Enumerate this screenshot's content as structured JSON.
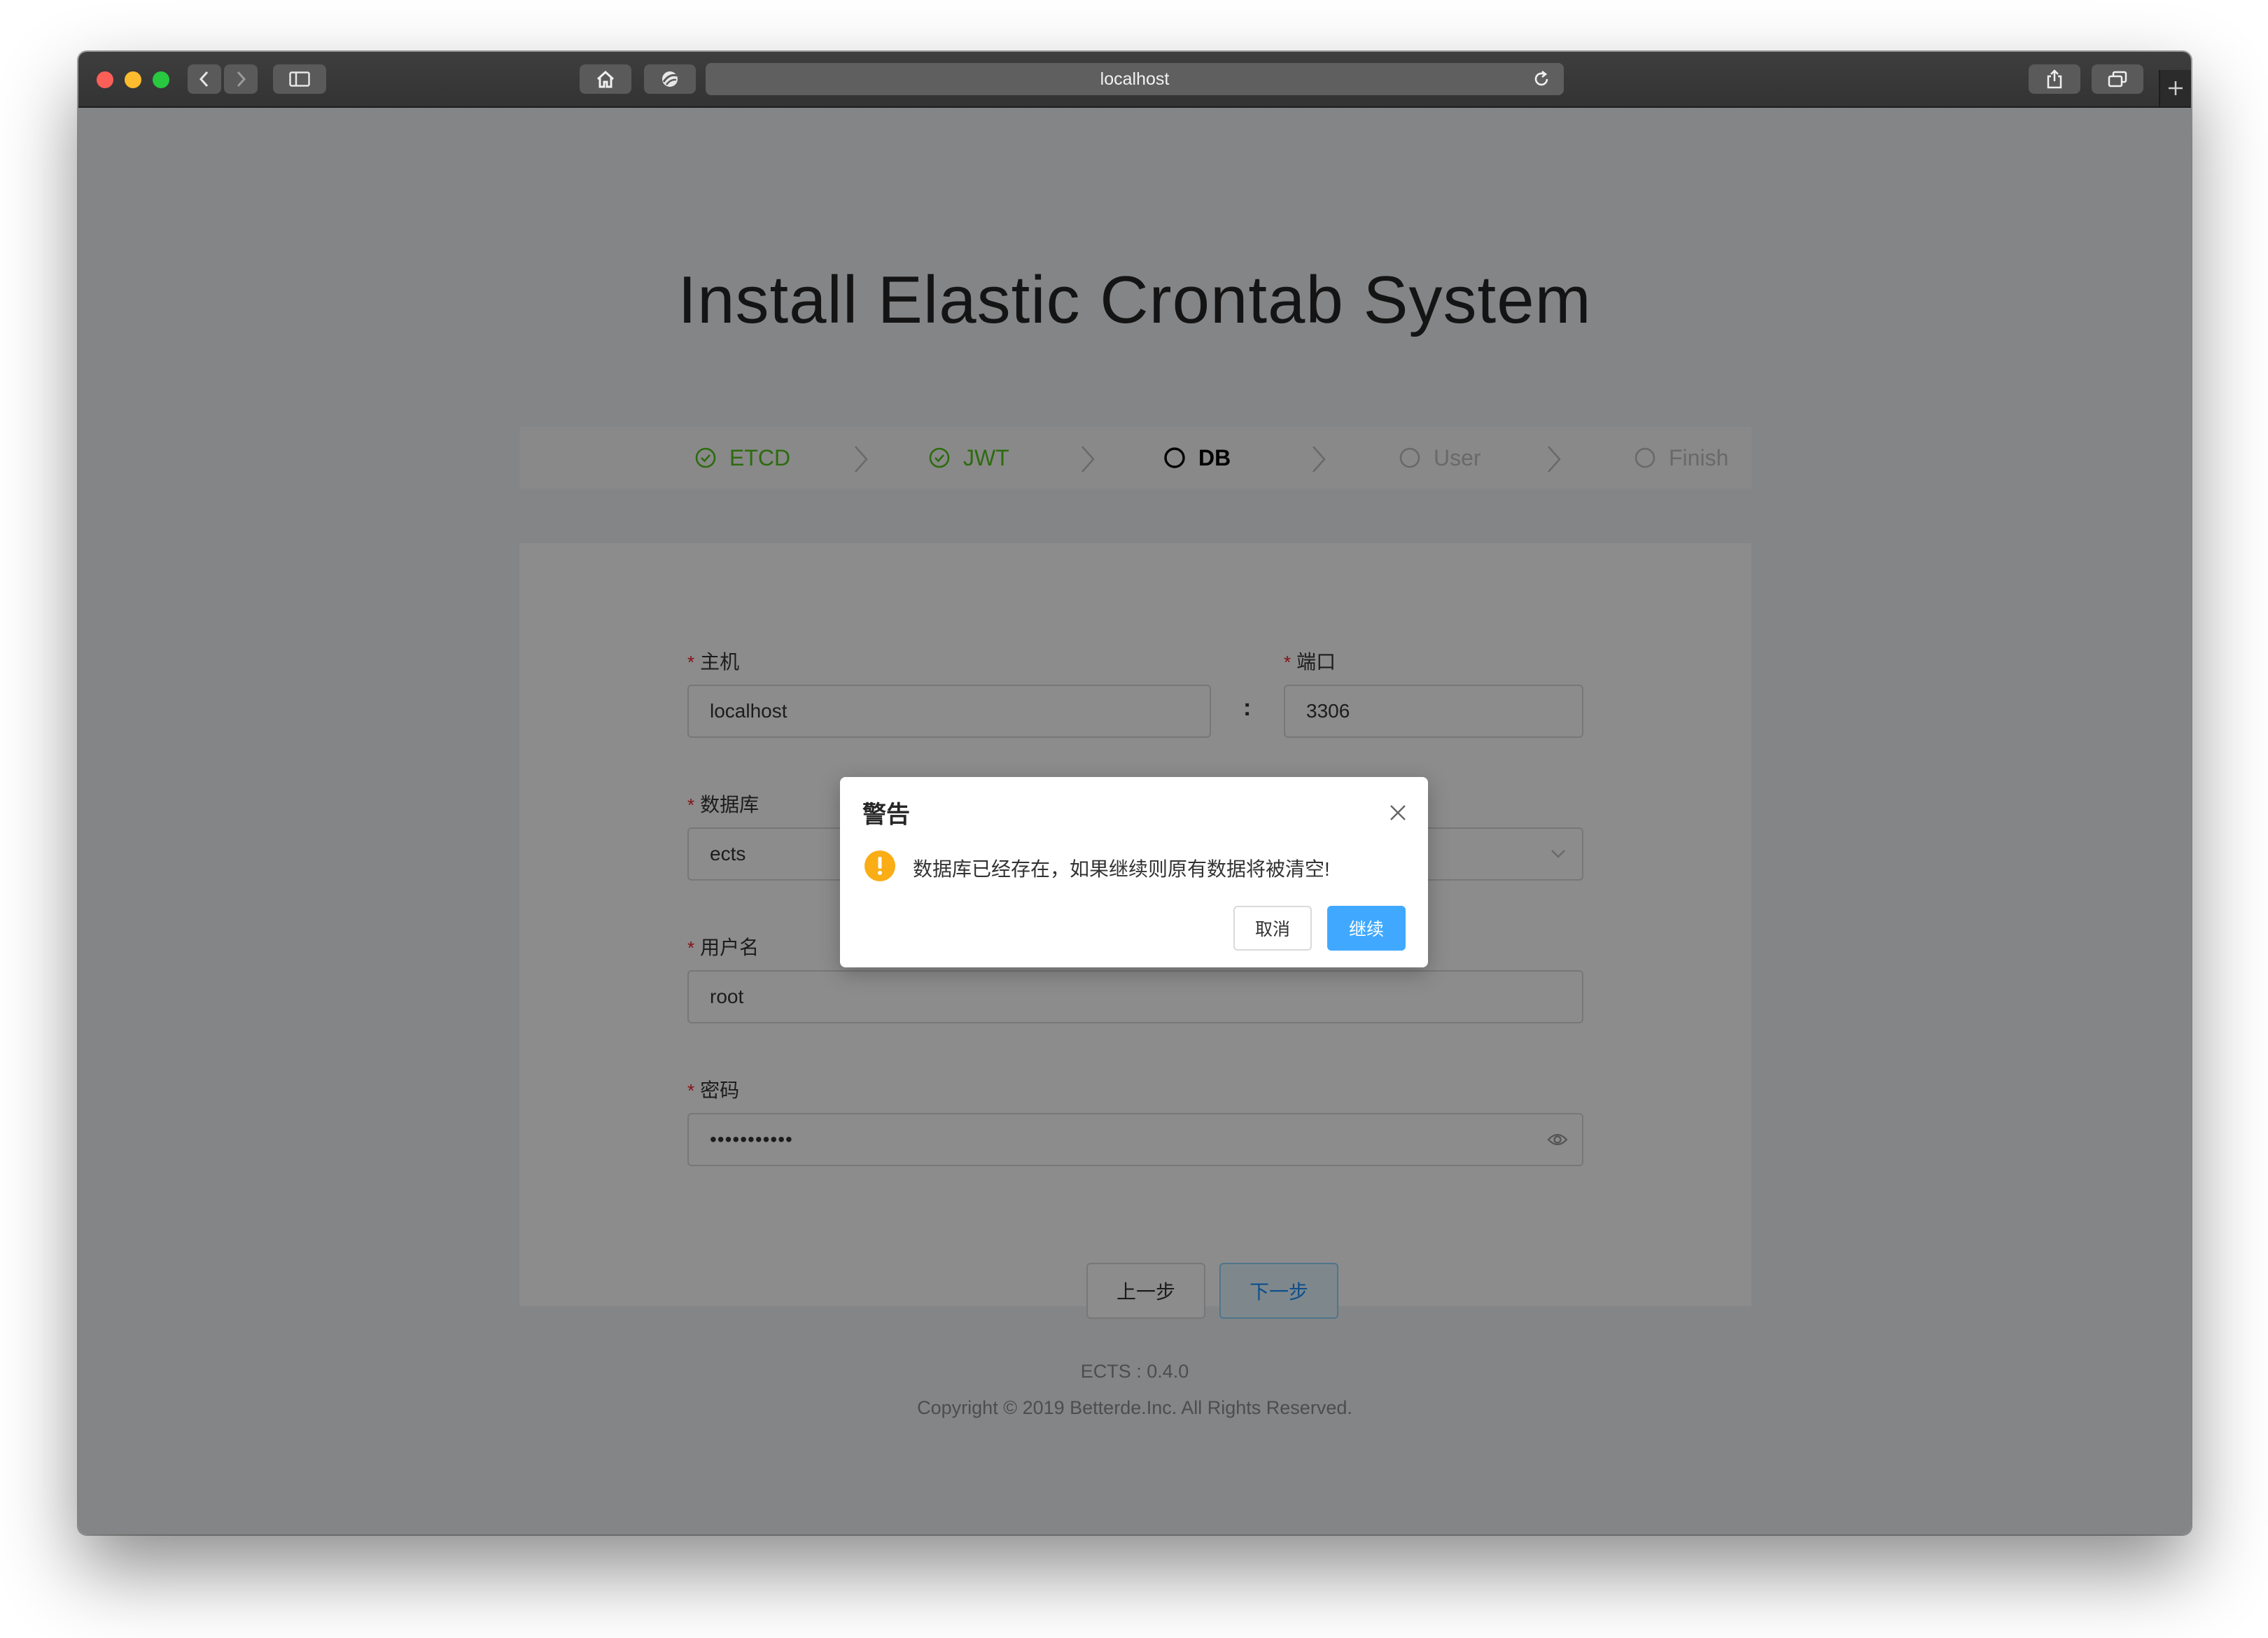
{
  "browser": {
    "url": "localhost"
  },
  "page": {
    "title": "Install Elastic Crontab System"
  },
  "steps": [
    {
      "label": "ETCD",
      "status": "done"
    },
    {
      "label": "JWT",
      "status": "done"
    },
    {
      "label": "DB",
      "status": "active"
    },
    {
      "label": "User",
      "status": "wait"
    },
    {
      "label": "Finish",
      "status": "wait"
    }
  ],
  "form": {
    "host": {
      "label": "主机",
      "value": "localhost"
    },
    "port": {
      "label": "端口",
      "value": "3306"
    },
    "colon": ":",
    "database": {
      "label": "数据库",
      "value": "ects"
    },
    "username": {
      "label": "用户名",
      "value": "root"
    },
    "password": {
      "label": "密码",
      "value": "•••••••••••"
    },
    "required_mark": "*",
    "prev_label": "上一步",
    "next_label": "下一步"
  },
  "footer": {
    "version": "ECTS : 0.4.0",
    "copyright": "Copyright © 2019 Betterde.Inc. All Rights Reserved."
  },
  "modal": {
    "title": "警告",
    "message": "数据库已经存在，如果继续则原有数据将被清空!",
    "cancel_label": "取消",
    "ok_label": "继续"
  },
  "colors": {
    "success": "#52c41a",
    "primary": "#1890ff",
    "warning": "#faad14",
    "required": "#f5222d"
  },
  "icons": {
    "step_done": "check-circle-icon",
    "step_pending": "circle-icon",
    "modal": "exclamation-circle-icon",
    "password_toggle": "eye-icon"
  }
}
